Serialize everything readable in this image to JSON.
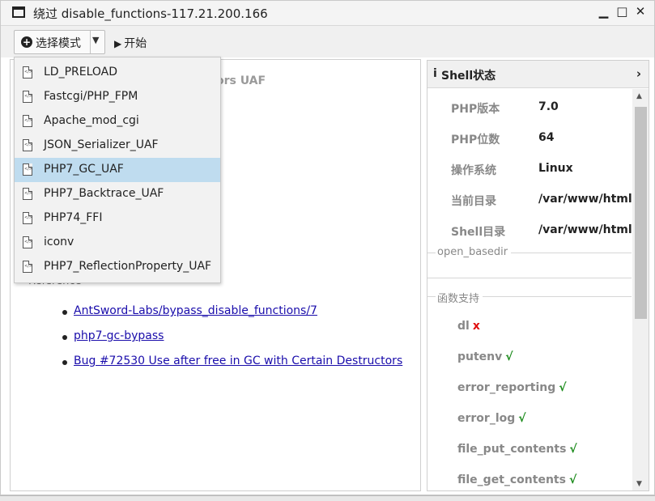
{
  "window": {
    "title": "绕过 disable_functions-117.21.200.166",
    "controls": {
      "minimize": "▁",
      "maximize": "□",
      "close": "✕"
    }
  },
  "toolbar": {
    "mode_button_label": "选择模式",
    "mode_icon": "plus-circle-icon",
    "start_label": "开始"
  },
  "dropdown": {
    "selected_index": 4,
    "items": [
      "LD_PRELOAD",
      "Fastcgi/PHP_FPM",
      "Apache_mod_cgi",
      "JSON_Serializer_UAF",
      "PHP7_GC_UAF",
      "PHP7_Backtrace_UAF",
      "PHP74_FFI",
      "iconv",
      "PHP7_ReflectionProperty_UAF"
    ]
  },
  "main": {
    "heading_fragment": "ors UAF",
    "reference_legend": "Reference",
    "references": [
      "AntSword-Labs/bypass_disable_functions/7",
      "php7-gc-bypass",
      "Bug #72530 Use after free in GC with Certain Destructors"
    ]
  },
  "shell_status": {
    "title": "Shell状态",
    "info_icon": "info-icon",
    "props": [
      {
        "key": "PHP版本",
        "value": "7.0"
      },
      {
        "key": "PHP位数",
        "value": "64"
      },
      {
        "key": "操作系统",
        "value": "Linux"
      },
      {
        "key": "当前目录",
        "value": "/var/www/html"
      },
      {
        "key": "Shell目录",
        "value": "/var/www/html"
      }
    ],
    "open_basedir_legend": "open_basedir",
    "functions_legend": "函数支持",
    "functions": [
      {
        "name": "dl",
        "mark": "x",
        "ok": false
      },
      {
        "name": "putenv",
        "mark": "√",
        "ok": true
      },
      {
        "name": "error_reporting",
        "mark": "√",
        "ok": true
      },
      {
        "name": "error_log",
        "mark": "√",
        "ok": true
      },
      {
        "name": "file_put_contents",
        "mark": "√",
        "ok": true
      },
      {
        "name": "file_get_contents",
        "mark": "√",
        "ok": true
      }
    ]
  },
  "colors": {
    "selected_item": "#bfdcef",
    "ok": "#1a8a1a",
    "fail": "#e01010",
    "link": "#1a0dab"
  }
}
